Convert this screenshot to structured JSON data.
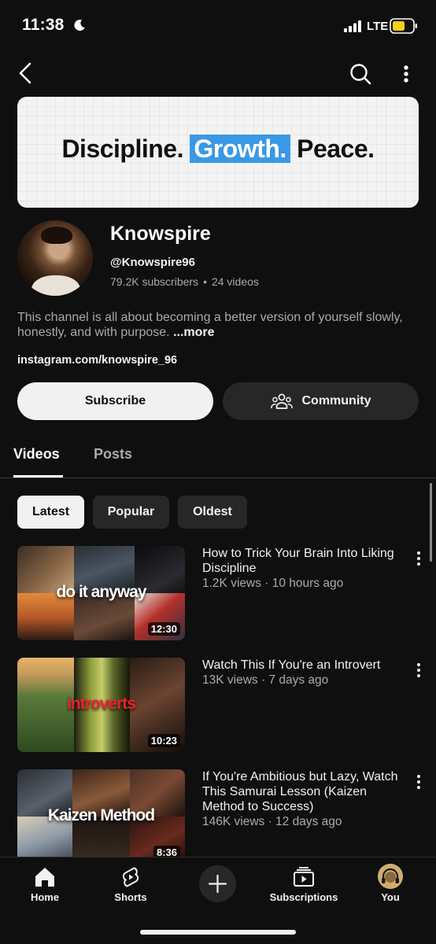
{
  "status_bar": {
    "time": "11:38",
    "network": "LTE",
    "icons": [
      "moon-icon",
      "signal-icon",
      "battery-icon"
    ]
  },
  "top_bar": {
    "icons": [
      "back-icon",
      "search-icon",
      "more-vertical-icon"
    ]
  },
  "banner": {
    "word1": "Discipline.",
    "word2": "Growth.",
    "word3": "Peace.",
    "highlight_color": "#3a98e6"
  },
  "channel": {
    "name": "Knowspire",
    "handle": "@Knowspire96",
    "subscribers": "79.2K subscribers",
    "video_count": "24 videos",
    "separator": "•",
    "description": "This channel is all about becoming a better version of yourself slowly, honestly, and with purpose.",
    "more_label": "...more",
    "link": "instagram.com/knowspire_96"
  },
  "actions": {
    "subscribe_label": "Subscribe",
    "community_label": "Community"
  },
  "tabs": [
    {
      "label": "Videos",
      "active": true
    },
    {
      "label": "Posts",
      "active": false
    }
  ],
  "chips": [
    {
      "label": "Latest",
      "active": true
    },
    {
      "label": "Popular",
      "active": false
    },
    {
      "label": "Oldest",
      "active": false
    }
  ],
  "videos": [
    {
      "title": "How to Trick Your Brain Into Liking Discipline",
      "meta": "1.2K views · 10 hours ago",
      "duration": "12:30",
      "thumb_text": "do it anyway",
      "thumb_text_color": "#ffffff"
    },
    {
      "title": "Watch This If You're an Introvert",
      "meta": "13K views · 7 days ago",
      "duration": "10:23",
      "thumb_text": "introverts",
      "thumb_text_color": "#e8232b"
    },
    {
      "title": "If You're Ambitious but Lazy, Watch This Samurai Lesson (Kaizen Method to Success)",
      "meta": "146K views · 12 days ago",
      "duration": "8:36",
      "thumb_text": "Kaizen Method",
      "thumb_text_color": "#ffffff"
    }
  ],
  "bottom_nav": [
    {
      "label": "Home",
      "icon": "home-icon"
    },
    {
      "label": "Shorts",
      "icon": "shorts-icon"
    },
    {
      "label": "",
      "icon": "plus-icon"
    },
    {
      "label": "Subscriptions",
      "icon": "subscriptions-icon"
    },
    {
      "label": "You",
      "icon": "avatar"
    }
  ]
}
